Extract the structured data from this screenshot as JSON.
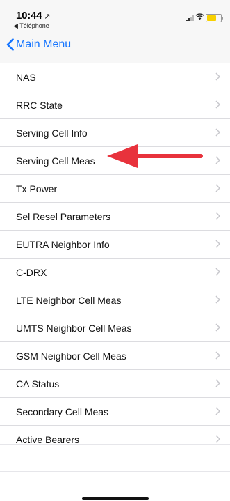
{
  "status_bar": {
    "time": "10:44",
    "location_glyph": "↗",
    "back_app": "◀ Téléphone"
  },
  "nav": {
    "back_label": "Main Menu"
  },
  "menu": {
    "items": [
      {
        "label": "NAS"
      },
      {
        "label": "RRC State"
      },
      {
        "label": "Serving Cell Info"
      },
      {
        "label": "Serving Cell Meas"
      },
      {
        "label": "Tx Power"
      },
      {
        "label": "Sel Resel Parameters"
      },
      {
        "label": "EUTRA Neighbor Info"
      },
      {
        "label": "C-DRX"
      },
      {
        "label": "LTE Neighbor Cell Meas"
      },
      {
        "label": "UMTS Neighbor Cell Meas"
      },
      {
        "label": "GSM Neighbor Cell Meas"
      },
      {
        "label": "CA Status"
      },
      {
        "label": "Secondary Cell Meas"
      },
      {
        "label": "Active Bearers"
      }
    ]
  },
  "colors": {
    "accent": "#1675ff",
    "annotation_arrow": "#e8323c",
    "battery": "#f7d000"
  }
}
